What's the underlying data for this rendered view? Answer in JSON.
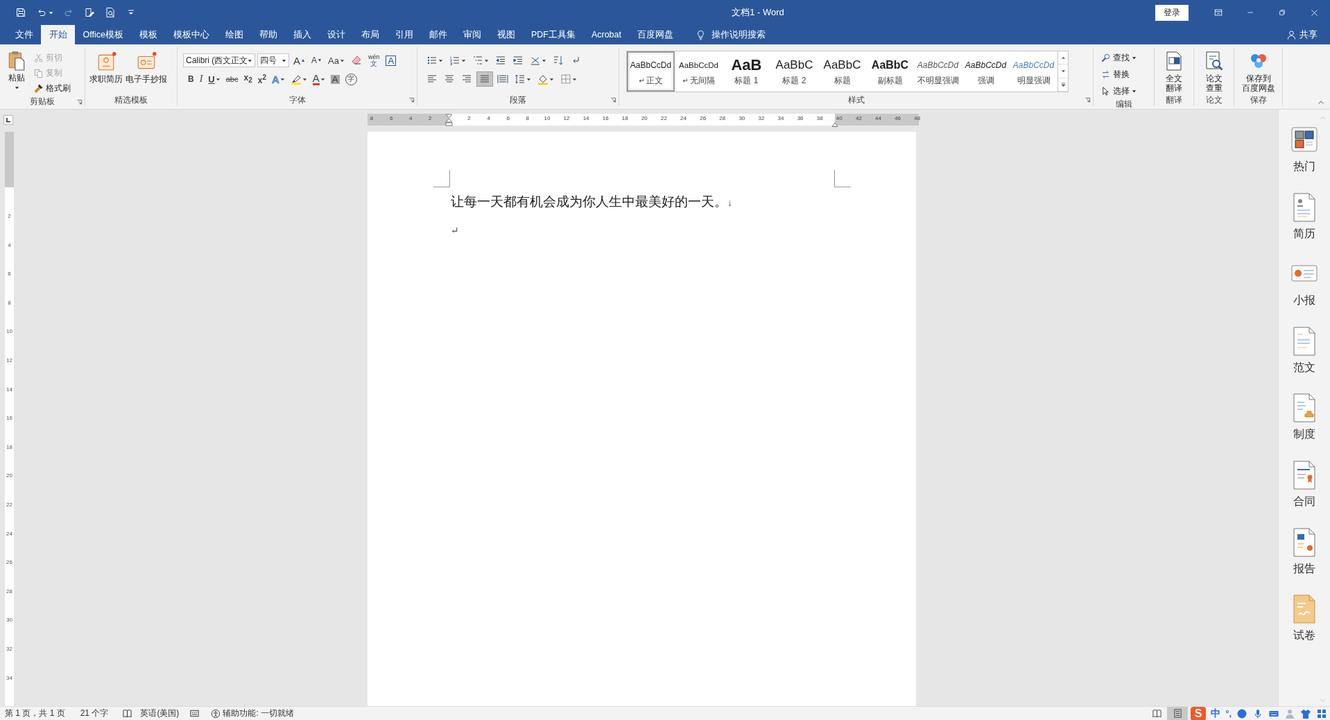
{
  "title_bar": {
    "quick_access": [
      {
        "kind": "save",
        "disabled": false
      },
      {
        "kind": "undo",
        "disabled": false
      },
      {
        "kind": "redo",
        "disabled": true
      },
      {
        "kind": "edit",
        "disabled": false
      },
      {
        "kind": "preview",
        "disabled": false
      },
      {
        "kind": "customize",
        "disabled": false
      }
    ],
    "title": "文档1 - Word",
    "login": "登录"
  },
  "tabs": [
    {
      "label": "文件",
      "selected": false
    },
    {
      "label": "开始",
      "selected": true
    },
    {
      "label": "Office模板",
      "selected": false
    },
    {
      "label": "模板",
      "selected": false
    },
    {
      "label": "模板中心",
      "selected": false
    },
    {
      "label": "绘图",
      "selected": false
    },
    {
      "label": "帮助",
      "selected": false
    },
    {
      "label": "插入",
      "selected": false
    },
    {
      "label": "设计",
      "selected": false
    },
    {
      "label": "布局",
      "selected": false
    },
    {
      "label": "引用",
      "selected": false
    },
    {
      "label": "邮件",
      "selected": false
    },
    {
      "label": "审阅",
      "selected": false
    },
    {
      "label": "视图",
      "selected": false
    },
    {
      "label": "PDF工具集",
      "selected": false
    },
    {
      "label": "Acrobat",
      "selected": false
    },
    {
      "label": "百度网盘",
      "selected": false
    }
  ],
  "tell_me": "操作说明搜索",
  "share": "共享",
  "ribbon": {
    "groups": [
      {
        "kind": "clipboard",
        "label": "剪贴板",
        "paste": "粘贴",
        "items": [
          {
            "label": "剪切",
            "disabled": true
          },
          {
            "label": "复制",
            "disabled": true
          },
          {
            "label": "格式刷",
            "disabled": false
          }
        ]
      },
      {
        "kind": "templates",
        "label": "精选模板",
        "items": [
          {
            "label": "求职简历"
          },
          {
            "label": "电子手抄报"
          }
        ]
      },
      {
        "kind": "font",
        "label": "字体",
        "font_name": "Calibri (西文正文",
        "font_size": "四号",
        "row1": [
          {
            "kind": "grow",
            "label": "A"
          },
          {
            "kind": "shrink",
            "label": "A"
          },
          {
            "kind": "case",
            "label": "Aa"
          },
          {
            "kind": "clear"
          },
          {
            "kind": "phonetic",
            "label": "wén",
            "label2": "文"
          },
          {
            "kind": "border",
            "label": "A"
          }
        ],
        "row2": [
          {
            "kind": "bold",
            "label": "B"
          },
          {
            "kind": "italic",
            "label": "I"
          },
          {
            "kind": "underline",
            "label": "U"
          },
          {
            "kind": "strike",
            "label": "abc"
          },
          {
            "kind": "sub",
            "label": "x$_{2}$"
          },
          {
            "kind": "sup",
            "label": "x$^{2}$"
          },
          {
            "kind": "effects",
            "label": "A"
          },
          {
            "kind": "highlight"
          },
          {
            "kind": "color",
            "label": "A"
          },
          {
            "kind": "shading",
            "label": "A"
          },
          {
            "kind": "enclose",
            "label": "字"
          }
        ]
      },
      {
        "kind": "paragraph",
        "label": "段落",
        "row1": [
          {
            "kind": "bullets"
          },
          {
            "kind": "numbering"
          },
          {
            "kind": "multilevel"
          },
          {
            "kind": "outdent"
          },
          {
            "kind": "indent"
          },
          {
            "kind": "asian"
          },
          {
            "kind": "sort"
          },
          {
            "kind": "marks"
          }
        ],
        "align": [
          {
            "kind": "left",
            "selected": false
          },
          {
            "kind": "center",
            "selected": false
          },
          {
            "kind": "right",
            "selected": false
          },
          {
            "kind": "justify",
            "selected": true
          },
          {
            "kind": "distributed",
            "selected": false
          }
        ],
        "row2": [
          {
            "kind": "spacing"
          },
          {
            "kind": "fill"
          },
          {
            "kind": "borders"
          }
        ]
      },
      {
        "kind": "styles",
        "label": "样式",
        "items": [
          {
            "kind": "normal",
            "preview": "AaBbCcDd",
            "mark": "↵",
            "label": "正文",
            "selected": true
          },
          {
            "kind": "nospacing",
            "preview": "AaBbCcDd",
            "mark": "↵",
            "label": "无间隔",
            "selected": false
          },
          {
            "kind": "heading1",
            "preview": "AaB",
            "label": "标题 1",
            "selected": false
          },
          {
            "kind": "heading2",
            "preview": "AaBbC",
            "label": "标题 2",
            "selected": false
          },
          {
            "kind": "title",
            "preview": "AaBbC",
            "label": "标题",
            "selected": false
          },
          {
            "kind": "subtitle",
            "preview": "AaBbC",
            "label": "副标题",
            "selected": false
          },
          {
            "kind": "subtle",
            "preview": "AaBbCcDd",
            "label": "不明显强调",
            "selected": false
          },
          {
            "kind": "emphasis",
            "preview": "AaBbCcDd",
            "label": "强调",
            "selected": false
          },
          {
            "kind": "intense",
            "preview": "AaBbCcDd",
            "label": "明显强调",
            "selected": false
          }
        ]
      },
      {
        "kind": "editing",
        "label": "编辑",
        "items": [
          {
            "label": "查找"
          },
          {
            "label": "替换"
          },
          {
            "label": "选择"
          }
        ]
      },
      {
        "kind": "translate",
        "label": "翻译",
        "button_lines": [
          "全文",
          "翻译"
        ]
      },
      {
        "kind": "thesis",
        "label": "论文",
        "button_lines": [
          "论文",
          "查重"
        ]
      },
      {
        "kind": "save",
        "label": "保存",
        "button_lines": [
          "保存到",
          "百度网盘"
        ]
      }
    ]
  },
  "ruler": {
    "left_numbers": [
      "8",
      "6",
      "4",
      "2"
    ],
    "right_numbers": [
      "2",
      "4",
      "6",
      "8",
      "10",
      "12",
      "14",
      "16",
      "18",
      "20",
      "22",
      "24",
      "26",
      "28",
      "30",
      "32",
      "34",
      "36",
      "38",
      "40",
      "42",
      "44",
      "46",
      "48"
    ]
  },
  "vertical_ruler": {
    "numbers": [
      "2",
      "4",
      "6",
      "8",
      "10",
      "12",
      "14",
      "16",
      "18",
      "20",
      "22",
      "24",
      "26",
      "28",
      "30",
      "32",
      "34"
    ]
  },
  "document": {
    "paragraphs": [
      {
        "text": "让每一天都有机会成为你人生中最美好的一天。",
        "mark": "↓"
      },
      {
        "mark": "↵"
      }
    ]
  },
  "sidebar": {
    "items": [
      {
        "label": "热门"
      },
      {
        "label": "简历"
      },
      {
        "label": "小报"
      },
      {
        "label": "范文"
      },
      {
        "label": "制度"
      },
      {
        "label": "合同"
      },
      {
        "label": "报告"
      },
      {
        "label": "试卷"
      }
    ]
  },
  "status_bar": {
    "page": "第 1 页，共 1 页",
    "words": "21 个字",
    "language": "英语(美国)",
    "accessibility": "辅助功能: 一切就绪",
    "views": [
      {
        "kind": "read",
        "selected": false
      },
      {
        "kind": "print",
        "selected": true
      }
    ],
    "ime": {
      "logo": "S",
      "mode": "中",
      "punctuation": "°,"
    }
  }
}
